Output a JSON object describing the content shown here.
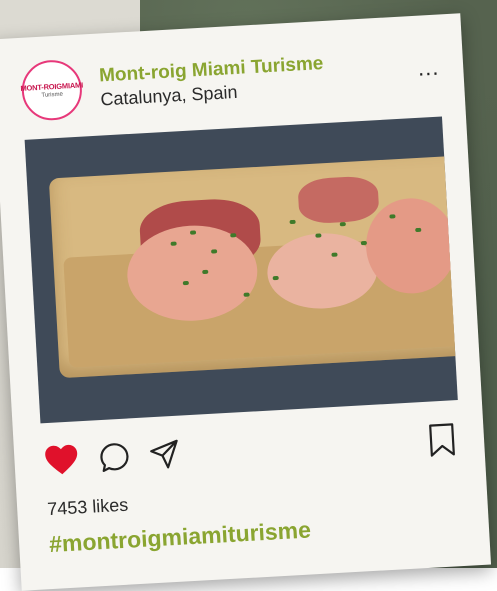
{
  "post": {
    "avatar": {
      "line1": "MONT-ROIGMIAMI",
      "line2": "Turisme"
    },
    "account_name": "Mont-roig Miami Turisme",
    "location": "Catalunya, Spain",
    "more_label": "...",
    "likes_text": "7453 likes",
    "hashtag": "#montroigmiamiturisme",
    "liked": true
  },
  "colors": {
    "accent_green": "#8aa531",
    "heart_red": "#e0112b",
    "avatar_ring": "#e7387a"
  },
  "icons": [
    "heart-icon",
    "comment-icon",
    "send-icon",
    "bookmark-icon",
    "more-icon"
  ]
}
